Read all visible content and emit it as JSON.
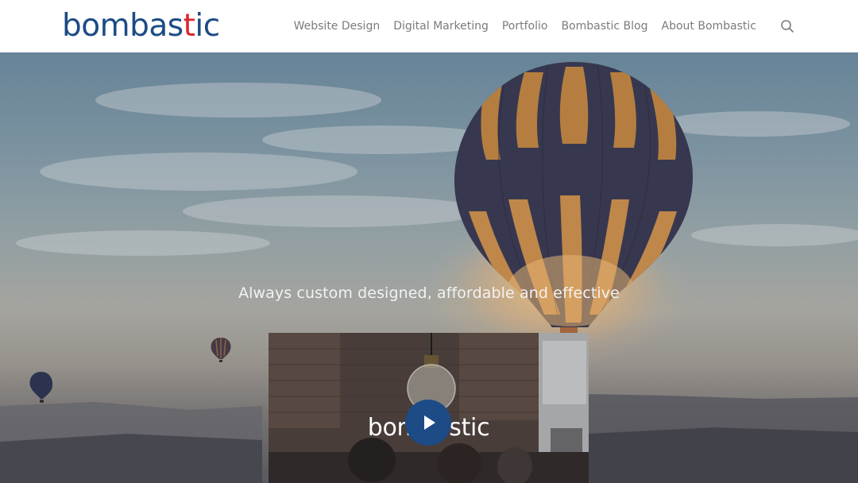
{
  "brand": {
    "logo_main": "bombas",
    "logo_accent": "t",
    "logo_end": "ic",
    "color_primary": "#1c4b86",
    "color_accent": "#d9272e"
  },
  "nav": {
    "items": [
      {
        "label": "Website Design"
      },
      {
        "label": "Digital Marketing"
      },
      {
        "label": "Portfolio"
      },
      {
        "label": "Bombastic Blog"
      },
      {
        "label": "About Bombastic"
      }
    ],
    "search_icon": "search-icon"
  },
  "hero": {
    "tagline": "Always custom designed, affordable and effective"
  },
  "video": {
    "brand_text": "bombastic",
    "play_icon": "play-icon"
  }
}
